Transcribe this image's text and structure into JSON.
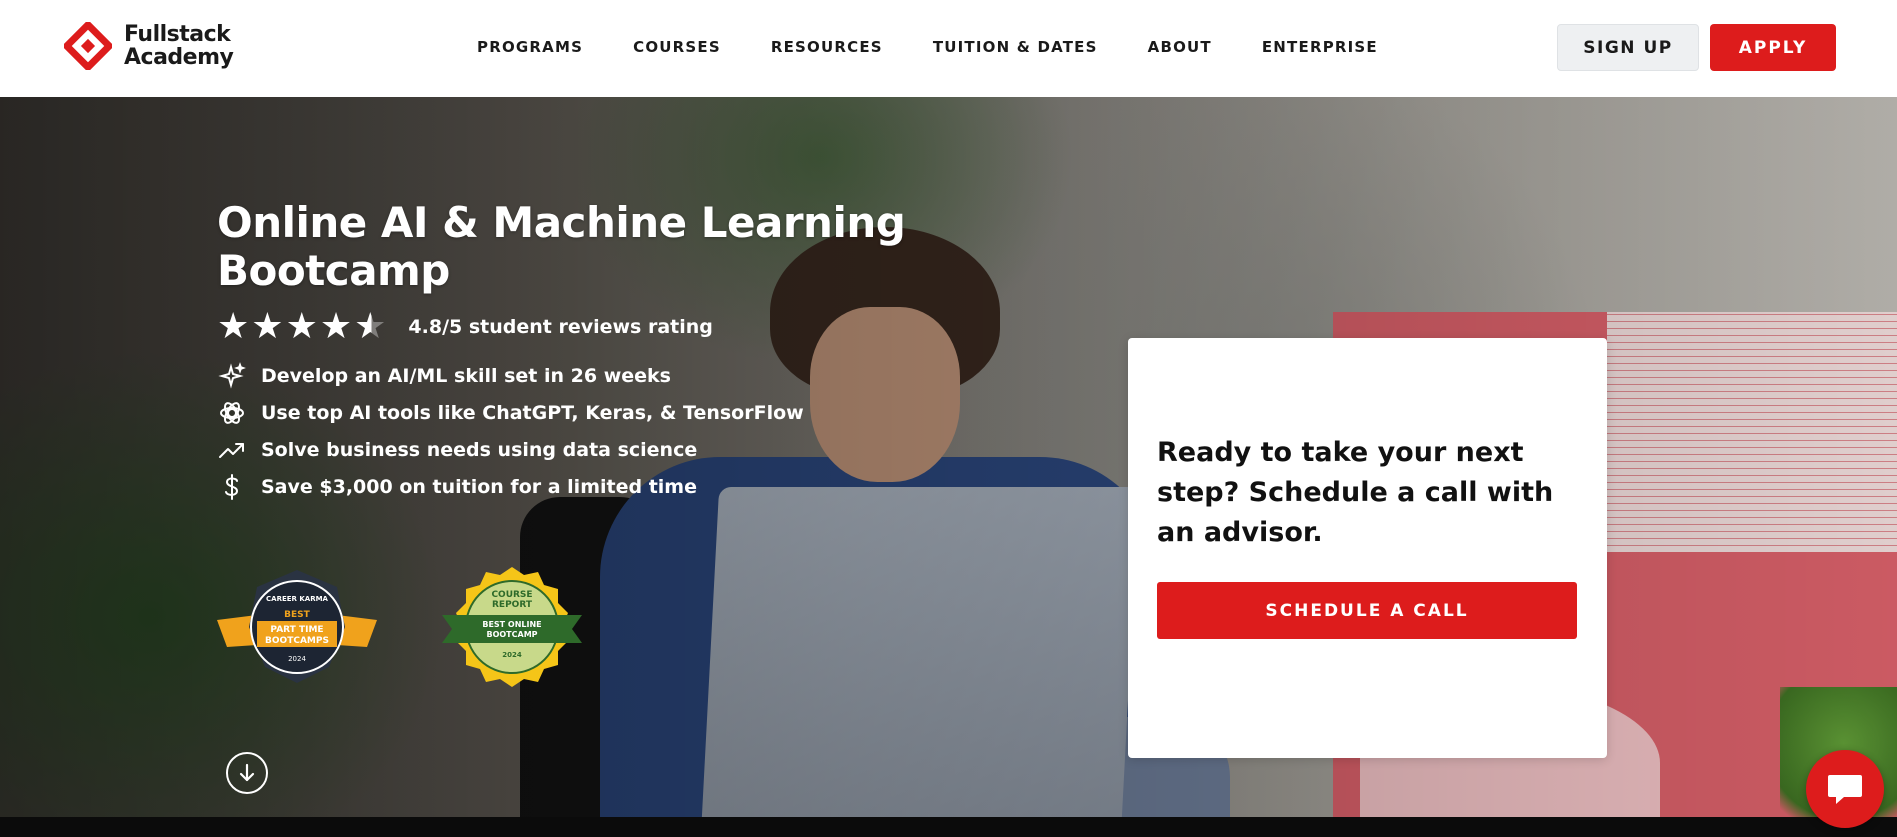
{
  "brand": {
    "line1": "Fullstack",
    "line2": "Academy",
    "accent": "#dd1c1c"
  },
  "nav": {
    "items": [
      {
        "label": "PROGRAMS"
      },
      {
        "label": "COURSES"
      },
      {
        "label": "RESOURCES"
      },
      {
        "label": "TUITION & DATES"
      },
      {
        "label": "ABOUT"
      },
      {
        "label": "ENTERPRISE"
      }
    ],
    "signup_label": "SIGN UP",
    "apply_label": "APPLY"
  },
  "hero": {
    "title": "Online AI & Machine Learning Bootcamp",
    "rating_value": 4.8,
    "rating_max": 5,
    "rating_text": "4.8/5 student reviews rating",
    "features": [
      {
        "icon": "sparkle-icon",
        "text": "Develop an AI/ML skill set in 26 weeks"
      },
      {
        "icon": "openai-icon",
        "text": "Use top AI tools like ChatGPT, Keras, & TensorFlow"
      },
      {
        "icon": "trending-up-icon",
        "text": "Solve business needs using data science"
      },
      {
        "icon": "dollar-icon",
        "text": "Save $3,000 on tuition for a limited time"
      }
    ],
    "badges": [
      {
        "org": "CAREER KARMA",
        "line1": "BEST",
        "line2": "PART TIME",
        "line3": "BOOTCAMPS",
        "year": "2024"
      },
      {
        "org1": "COURSE",
        "org2": "REPORT",
        "line1": "BEST ONLINE",
        "line2": "BOOTCAMP",
        "year": "2024"
      }
    ]
  },
  "form_card": {
    "heading": "Ready to take your next step? Schedule a call with an advisor.",
    "button_label": "SCHEDULE A CALL"
  }
}
